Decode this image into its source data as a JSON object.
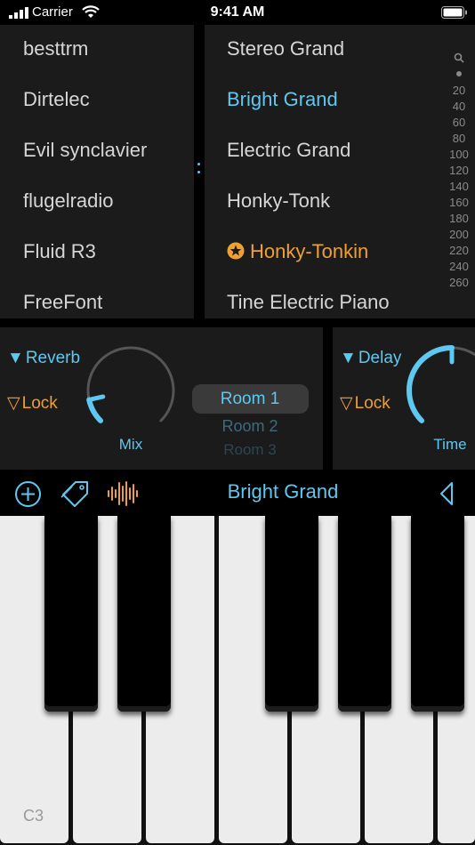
{
  "status_bar": {
    "carrier": "Carrier",
    "time": "9:41 AM"
  },
  "soundfonts": [
    "besttrm",
    "Dirtelec",
    "Evil synclavier",
    "flugelradio",
    "Fluid R3",
    "FreeFont"
  ],
  "presets": [
    {
      "label": "Stereo Grand",
      "state": "normal"
    },
    {
      "label": "Bright Grand",
      "state": "selected"
    },
    {
      "label": "Electric Grand",
      "state": "normal"
    },
    {
      "label": "Honky-Tonk",
      "state": "normal"
    },
    {
      "label": "Honky-Tonkin",
      "state": "favorite"
    },
    {
      "label": "Tine Electric Piano",
      "state": "normal"
    }
  ],
  "index_labels": [
    "20",
    "40",
    "60",
    "80",
    "100",
    "120",
    "140",
    "160",
    "180",
    "200",
    "220",
    "240",
    "260"
  ],
  "reverb": {
    "toggle_label": "Reverb",
    "lock_label": "Lock",
    "knob_label": "Mix",
    "mix_level": 0.12,
    "room_options": [
      "Room 1",
      "Room 2",
      "Room 3"
    ],
    "selected_room": "Room 1"
  },
  "delay": {
    "toggle_label": "Delay",
    "lock_label": "Lock",
    "knob_label": "Time",
    "time_level": 0.5
  },
  "toolbar": {
    "preset_title": "Bright Grand"
  },
  "keyboard": {
    "first_key_label": "C3"
  },
  "colors": {
    "accent_blue": "#5ec8f0",
    "accent_orange": "#f0a030",
    "panel_bg": "#1b1b1b",
    "text_gray": "#d6d6d6"
  },
  "icons": {
    "wifi": "wifi-icon",
    "battery": "battery-icon",
    "signal": "signal-icon",
    "search": "search-icon",
    "add": "add-icon",
    "tag": "tag-icon",
    "waveform": "waveform-icon",
    "back": "back-triangle-icon",
    "favorite": "star-badge-icon"
  }
}
